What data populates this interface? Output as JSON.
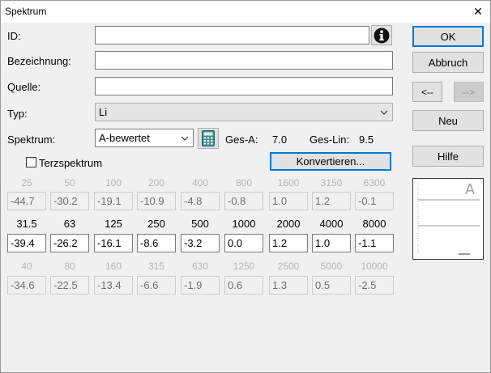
{
  "window": {
    "title": "Spektrum",
    "close_glyph": "✕"
  },
  "fields": {
    "id_label": "ID:",
    "id_value": "",
    "bezeichnung_label": "Bezeichnung:",
    "bezeichnung_value": "",
    "quelle_label": "Quelle:",
    "quelle_value": "",
    "typ_label": "Typ:",
    "typ_value": "Li",
    "spektrum_label": "Spektrum:",
    "spektrum_value": "A-bewertet"
  },
  "totals": {
    "ges_a_label": "Ges-A:",
    "ges_a_value": "7.0",
    "ges_lin_label": "Ges-Lin:",
    "ges_lin_value": "9.5"
  },
  "terz": {
    "label": "Terzspektrum",
    "checked": false
  },
  "buttons": {
    "ok": "OK",
    "abbruch": "Abbruch",
    "prev": "<--",
    "next": "-->",
    "neu": "Neu",
    "hilfe": "Hilfe",
    "konvertieren": "Konvertieren..."
  },
  "bands": {
    "upper_freqs": [
      "25",
      "50",
      "100",
      "200",
      "400",
      "800",
      "1600",
      "3150",
      "6300"
    ],
    "upper_values": [
      "-44.7",
      "-30.2",
      "-19.1",
      "-10.9",
      "-4.8",
      "-0.8",
      "1.0",
      "1.2",
      "-0.1"
    ],
    "main_freqs": [
      "31.5",
      "63",
      "125",
      "250",
      "500",
      "1000",
      "2000",
      "4000",
      "8000"
    ],
    "main_values": [
      "-39.4",
      "-26.2",
      "-16.1",
      "-8.6",
      "-3.2",
      "0.0",
      "1.2",
      "1.0",
      "-1.1"
    ],
    "lower_freqs": [
      "40",
      "80",
      "160",
      "315",
      "630",
      "1250",
      "2500",
      "5000",
      "10000"
    ],
    "lower_values": [
      "-34.6",
      "-22.5",
      "-13.4",
      "-6.6",
      "-1.9",
      "0.6",
      "1.3",
      "0.5",
      "-2.5"
    ]
  },
  "preview": {
    "letter": "A"
  },
  "icons": [
    "info-icon",
    "calculator-icon",
    "close-icon",
    "chevron-down-icon"
  ]
}
